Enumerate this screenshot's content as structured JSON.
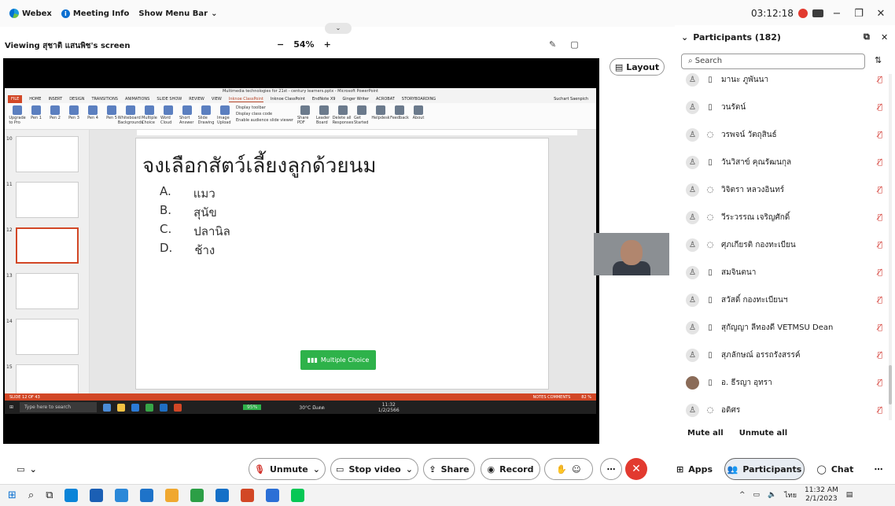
{
  "topbar": {
    "app": "Webex",
    "meeting_info": "Meeting Info",
    "show_menu": "Show Menu Bar",
    "time": "03:12:18"
  },
  "view": {
    "title": "Viewing สุชาติ แสนพิช's screen",
    "zoom_out": "−",
    "zoom": "54%",
    "zoom_in": "+"
  },
  "layout_label": "Layout",
  "ppt": {
    "title": "Multimedia technologies for 21st - century learners.pptx - Microsoft PowerPoint",
    "tabs": [
      "FILE",
      "HOME",
      "INSERT",
      "DESIGN",
      "TRANSITIONS",
      "ANIMATIONS",
      "SLIDE SHOW",
      "REVIEW",
      "VIEW",
      "Inknoe ClassPoint",
      "Inknoe ClassPoint",
      "EndNote X9",
      "Ginger Writer",
      "ACROBAT",
      "STORYBOARDING"
    ],
    "user": "Suchart Saenpich",
    "ribbon": [
      "Upgrade to Pro",
      "Pen 1",
      "Pen 2",
      "Pen 3",
      "Pen 4",
      "Pen 5",
      "Whiteboard Backgrounds",
      "Multiple Choice",
      "Word Cloud",
      "Short Answer",
      "Slide Drawing",
      "Image Upload",
      "Share PDF",
      "Leader Board",
      "Delete all Responses",
      "Get Started",
      "Helpdesk",
      "Feedback",
      "About"
    ],
    "checks": [
      "Display toolbar",
      "Display class code",
      "Enable audience slide viewer"
    ],
    "slide_numbers": [
      "10",
      "11",
      "12",
      "13",
      "14",
      "15"
    ],
    "status_left": "SLIDE 12 OF 43",
    "status_right": "NOTES   COMMENTS",
    "status_zoom": "82 %",
    "taskbar_search": "Type here to search",
    "taskbar_weather": "30°C มีแดด",
    "taskbar_time": "11:32",
    "taskbar_date": "1/2/2566",
    "taskbar_percent": "95%"
  },
  "slide": {
    "question": "จงเลือกสัตว์เลี้ยงลูกด้วยนม",
    "options": [
      {
        "letter": "A.",
        "text": "แมว"
      },
      {
        "letter": "B.",
        "text": "สุนัข"
      },
      {
        "letter": "C.",
        "text": "ปลานิล"
      },
      {
        "letter": "D.",
        "text": "ช้าง"
      }
    ],
    "button": "Multiple Choice"
  },
  "panel": {
    "title": "Participants (182)",
    "search_placeholder": "Search",
    "participants": [
      {
        "name": "มานะ ภูพันนา",
        "device": "desktop"
      },
      {
        "name": "วนรัตน์",
        "device": "desktop"
      },
      {
        "name": "วรพจน์ วัตถุสินธ์",
        "device": "audio"
      },
      {
        "name": "วันวิสาข์ คุณรัฒนกุล",
        "device": "desktop"
      },
      {
        "name": "วิจิตรา หลวงอินทร์",
        "device": "audio"
      },
      {
        "name": "วีระวรรณ เจริญศักดิ์",
        "device": "audio"
      },
      {
        "name": "ศุภเกียรติ กองทะเบียน",
        "device": "audio"
      },
      {
        "name": "สมจินตนา",
        "device": "desktop"
      },
      {
        "name": "สวัสดิ์ กองทะเบียนฯ",
        "device": "desktop"
      },
      {
        "name": "สุกัญญา ลีทองดี VETMSU Dean",
        "device": "desktop"
      },
      {
        "name": "สุภลักษณ์ อรรถรังสรรค์",
        "device": "desktop"
      },
      {
        "name": "อ. ธีรญา อุทรา",
        "device": "desktop",
        "photo": true
      },
      {
        "name": "อดิศร",
        "device": "audio"
      }
    ],
    "mute_all": "Mute all",
    "unmute_all": "Unmute all"
  },
  "controls": {
    "unmute": "Unmute",
    "stop_video": "Stop video",
    "share": "Share",
    "record": "Record",
    "apps": "Apps",
    "participants": "Participants",
    "chat": "Chat"
  },
  "tray": {
    "time": "11:32 AM",
    "date": "2/1/2023",
    "lang": "ไทย"
  },
  "colors": {
    "accent": "#0a6fd1",
    "danger": "#e23a2f",
    "mute_red": "#d2352e",
    "mc_green": "#2eb24a",
    "ppt_orange": "#d24726"
  }
}
